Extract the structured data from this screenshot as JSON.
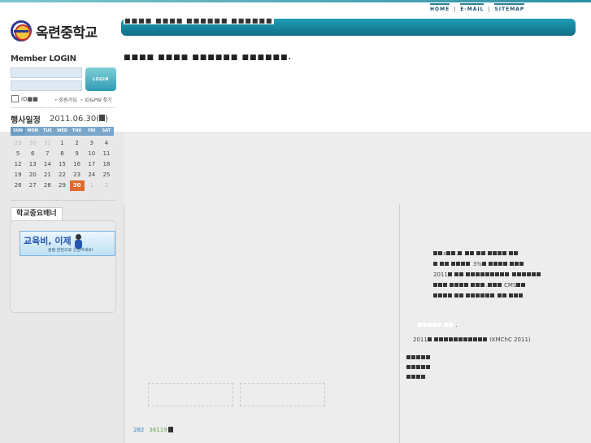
{
  "nav": {
    "home": "HOME",
    "email": "E-MAIL",
    "sitemap": "SITEMAP"
  },
  "logo": {
    "name": "옥련중학교"
  },
  "header": {
    "bar_text": "■■■■ ■■■■ ■■■■■■ ■■■■■■",
    "page_title": "■■■■ ■■■■ ■■■■■■ ■■■■■■."
  },
  "login": {
    "title": "Member LOGIN",
    "button": "LOGIN",
    "remember_label": "ID■■",
    "join_link": "회원가입",
    "find_link": "ID&PW 찾기"
  },
  "calendar": {
    "title": "행사일정",
    "date": "2011.06.30(",
    "days": [
      "SUN",
      "MON",
      "TUE",
      "WED",
      "THU",
      "FRI",
      "SAT"
    ],
    "cells": [
      "29",
      "30",
      "31",
      "1",
      "2",
      "3",
      "4",
      "5",
      "6",
      "7",
      "8",
      "9",
      "10",
      "11",
      "12",
      "13",
      "14",
      "15",
      "16",
      "17",
      "18",
      "19",
      "20",
      "21",
      "22",
      "23",
      "24",
      "25",
      "26",
      "27",
      "28",
      "29",
      "30",
      "1",
      "2"
    ],
    "other_month": [
      0,
      1,
      2,
      33,
      34
    ],
    "today": 32
  },
  "school_banner": {
    "tab": "학교중요배너",
    "headline": "교육비, 이제",
    "sub": "슬림 한번으로 신청하세요!"
  },
  "counter": {
    "today": "282",
    "total": "36119"
  },
  "notice": {
    "x": "x",
    "pct": "3%",
    "year": "2011",
    "cms": "CMS",
    "year2": "2011",
    "kmchc": "(KMChC 2011)"
  },
  "colors": {
    "accent": "#1a8aa4",
    "today": "#e06a2c",
    "cal_head": "#7aa6cc"
  }
}
